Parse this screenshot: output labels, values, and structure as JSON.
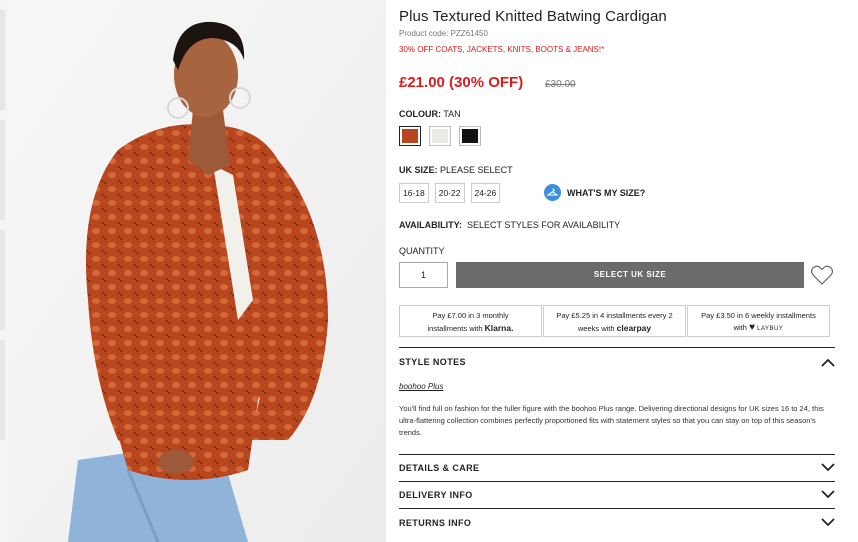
{
  "product": {
    "title": "Plus Textured Knitted Batwing Cardigan",
    "code": "Product code: PZZ61450",
    "promo": "30% OFF COATS, JACKETS, KNITS, BOOTS & JEANS!*",
    "price_now": "£21.00 (30% OFF)",
    "price_was": "£30.00"
  },
  "colour": {
    "label": "COLOUR:",
    "value": "TAN",
    "swatches": [
      {
        "name": "tan",
        "color": "#b8461e",
        "selected": true
      },
      {
        "name": "cream",
        "color": "#ecece4",
        "selected": false
      },
      {
        "name": "black",
        "color": "#111111",
        "selected": false
      }
    ]
  },
  "size": {
    "label": "UK SIZE:",
    "value": "PLEASE SELECT",
    "options": [
      "16-18",
      "20-22",
      "24-26"
    ],
    "whats_my_size": "WHAT'S MY SIZE?"
  },
  "availability": {
    "label": "AVAILABILITY:",
    "value": "SELECT STYLES FOR AVAILABILITY"
  },
  "quantity": {
    "label": "QUANTITY",
    "value": "1"
  },
  "cta": {
    "select_size": "SELECT UK SIZE"
  },
  "payments": [
    {
      "line1": "Pay £7.00 in 3 monthly",
      "line2": "installments with",
      "brand": "Klarna."
    },
    {
      "line1": "Pay £5.25 in 4 installments every 2",
      "line2": "weeks with",
      "brand": "clearpay"
    },
    {
      "line1": "Pay £3.50 in 6 weekly installments",
      "line2": "with",
      "brand": "LAYBUY"
    }
  ],
  "style_notes": {
    "heading": "STYLE NOTES",
    "brand": "boohoo Plus",
    "text": "You'll find full on fashion for the fuller figure with the boohoo Plus range. Delivering directional designs for UK sizes 16 to 24, this ultra-flattering collection combines perfectly proportioned fits with statement styles so that you can stay on top of this season's trends."
  },
  "accordion": {
    "details": "DETAILS & CARE",
    "delivery": "DELIVERY INFO",
    "returns": "RETURNS INFO"
  },
  "colors": {
    "sale_red": "#d91d1d",
    "button_grey": "#6b6b6b",
    "info_blue": "#3d8fd9"
  }
}
